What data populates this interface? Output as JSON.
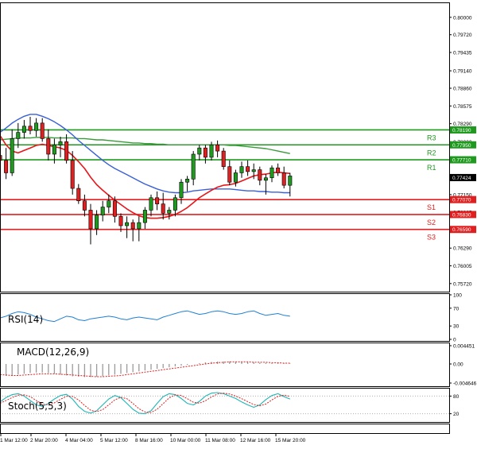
{
  "chart_data": {
    "type": "candlestick",
    "main": {
      "ylim": [
        0.7559,
        0.8024
      ],
      "price_ticks": [
        "0.80000",
        "0.79720",
        "0.79435",
        "0.79140",
        "0.78860",
        "0.78575",
        "0.78290",
        "0.78000",
        "0.77715",
        "0.77435",
        "0.77150",
        "0.76865",
        "0.76580",
        "0.76290",
        "0.76005",
        "0.75720"
      ],
      "tick_values": [
        0.8,
        0.7972,
        0.79435,
        0.7914,
        0.7886,
        0.78575,
        0.7829,
        0.78,
        0.77715,
        0.77435,
        0.7715,
        0.76865,
        0.7658,
        0.7629,
        0.76005,
        0.7572
      ],
      "current_price": {
        "label": "0.77424",
        "value": 0.77424
      },
      "levels": [
        {
          "name": "R3",
          "label": "0.78190",
          "value": 0.7819,
          "color": "#1f9a1f"
        },
        {
          "name": "R2",
          "label": "0.77950",
          "value": 0.7795,
          "color": "#1f9a1f"
        },
        {
          "name": "R1",
          "label": "0.77710",
          "value": 0.7771,
          "color": "#1f9a1f"
        },
        {
          "name": "S1",
          "label": "0.77070",
          "value": 0.7707,
          "color": "#e02020"
        },
        {
          "name": "S2",
          "label": "0.76830",
          "value": 0.7683,
          "color": "#e02020"
        },
        {
          "name": "S3",
          "label": "0.76590",
          "value": 0.7659,
          "color": "#e02020"
        }
      ],
      "candles": [
        {
          "o": 0.7778,
          "h": 0.78,
          "l": 0.776,
          "c": 0.777
        },
        {
          "o": 0.777,
          "h": 0.779,
          "l": 0.774,
          "c": 0.775
        },
        {
          "o": 0.775,
          "h": 0.782,
          "l": 0.7745,
          "c": 0.7805
        },
        {
          "o": 0.7805,
          "h": 0.783,
          "l": 0.779,
          "c": 0.7815
        },
        {
          "o": 0.7815,
          "h": 0.7835,
          "l": 0.7805,
          "c": 0.7825
        },
        {
          "o": 0.7825,
          "h": 0.784,
          "l": 0.7812,
          "c": 0.7818
        },
        {
          "o": 0.7818,
          "h": 0.7838,
          "l": 0.7808,
          "c": 0.783
        },
        {
          "o": 0.783,
          "h": 0.7838,
          "l": 0.78,
          "c": 0.7805
        },
        {
          "o": 0.7805,
          "h": 0.782,
          "l": 0.777,
          "c": 0.778
        },
        {
          "o": 0.778,
          "h": 0.7805,
          "l": 0.7765,
          "c": 0.7795
        },
        {
          "o": 0.7795,
          "h": 0.7808,
          "l": 0.7775,
          "c": 0.78
        },
        {
          "o": 0.78,
          "h": 0.7812,
          "l": 0.7765,
          "c": 0.777
        },
        {
          "o": 0.777,
          "h": 0.7785,
          "l": 0.7715,
          "c": 0.7725
        },
        {
          "o": 0.7725,
          "h": 0.7732,
          "l": 0.77,
          "c": 0.7705
        },
        {
          "o": 0.7705,
          "h": 0.7715,
          "l": 0.768,
          "c": 0.769
        },
        {
          "o": 0.769,
          "h": 0.77,
          "l": 0.7635,
          "c": 0.766
        },
        {
          "o": 0.766,
          "h": 0.769,
          "l": 0.765,
          "c": 0.7682
        },
        {
          "o": 0.7682,
          "h": 0.7705,
          "l": 0.7672,
          "c": 0.7695
        },
        {
          "o": 0.7695,
          "h": 0.7715,
          "l": 0.7685,
          "c": 0.7705
        },
        {
          "o": 0.7705,
          "h": 0.7712,
          "l": 0.767,
          "c": 0.768
        },
        {
          "o": 0.768,
          "h": 0.7685,
          "l": 0.7655,
          "c": 0.7665
        },
        {
          "o": 0.7665,
          "h": 0.768,
          "l": 0.7645,
          "c": 0.767
        },
        {
          "o": 0.767,
          "h": 0.7675,
          "l": 0.764,
          "c": 0.766
        },
        {
          "o": 0.766,
          "h": 0.768,
          "l": 0.764,
          "c": 0.767
        },
        {
          "o": 0.767,
          "h": 0.7695,
          "l": 0.766,
          "c": 0.769
        },
        {
          "o": 0.769,
          "h": 0.7715,
          "l": 0.768,
          "c": 0.771
        },
        {
          "o": 0.771,
          "h": 0.772,
          "l": 0.769,
          "c": 0.77
        },
        {
          "o": 0.77,
          "h": 0.7718,
          "l": 0.7675,
          "c": 0.7685
        },
        {
          "o": 0.7685,
          "h": 0.7695,
          "l": 0.7675,
          "c": 0.769
        },
        {
          "o": 0.769,
          "h": 0.7715,
          "l": 0.768,
          "c": 0.771
        },
        {
          "o": 0.771,
          "h": 0.774,
          "l": 0.77,
          "c": 0.7735
        },
        {
          "o": 0.7735,
          "h": 0.7745,
          "l": 0.772,
          "c": 0.774
        },
        {
          "o": 0.774,
          "h": 0.7785,
          "l": 0.773,
          "c": 0.778
        },
        {
          "o": 0.778,
          "h": 0.7795,
          "l": 0.777,
          "c": 0.779
        },
        {
          "o": 0.779,
          "h": 0.7795,
          "l": 0.7765,
          "c": 0.7775
        },
        {
          "o": 0.7775,
          "h": 0.78,
          "l": 0.777,
          "c": 0.7795
        },
        {
          "o": 0.7795,
          "h": 0.7802,
          "l": 0.7775,
          "c": 0.7785
        },
        {
          "o": 0.7785,
          "h": 0.779,
          "l": 0.7755,
          "c": 0.776
        },
        {
          "o": 0.776,
          "h": 0.777,
          "l": 0.773,
          "c": 0.7735
        },
        {
          "o": 0.7735,
          "h": 0.7755,
          "l": 0.7728,
          "c": 0.775
        },
        {
          "o": 0.775,
          "h": 0.7768,
          "l": 0.7742,
          "c": 0.776
        },
        {
          "o": 0.776,
          "h": 0.777,
          "l": 0.7745,
          "c": 0.7752
        },
        {
          "o": 0.7752,
          "h": 0.7765,
          "l": 0.774,
          "c": 0.7755
        },
        {
          "o": 0.7755,
          "h": 0.776,
          "l": 0.773,
          "c": 0.7738
        },
        {
          "o": 0.7738,
          "h": 0.7748,
          "l": 0.7715,
          "c": 0.7742
        },
        {
          "o": 0.7742,
          "h": 0.7762,
          "l": 0.7735,
          "c": 0.7758
        },
        {
          "o": 0.7758,
          "h": 0.7765,
          "l": 0.7745,
          "c": 0.775
        },
        {
          "o": 0.775,
          "h": 0.776,
          "l": 0.7725,
          "c": 0.773
        },
        {
          "o": 0.773,
          "h": 0.775,
          "l": 0.7712,
          "c": 0.7745
        }
      ],
      "ma_fast": [
        0.781,
        0.7795,
        0.7785,
        0.7782,
        0.7786,
        0.779,
        0.7794,
        0.7796,
        0.7794,
        0.7792,
        0.779,
        0.7786,
        0.7778,
        0.7768,
        0.7757,
        0.7743,
        0.7731,
        0.7722,
        0.7714,
        0.7706,
        0.7699,
        0.7692,
        0.7686,
        0.7681,
        0.7678,
        0.7677,
        0.7677,
        0.7678,
        0.768,
        0.7683,
        0.7688,
        0.7694,
        0.7702,
        0.771,
        0.7716,
        0.7722,
        0.7727,
        0.773,
        0.7731,
        0.7733,
        0.7737,
        0.7741,
        0.7745,
        0.7747,
        0.7748,
        0.775,
        0.7751,
        0.775,
        0.7749
      ],
      "ma_mid": [
        0.7815,
        0.7822,
        0.783,
        0.7836,
        0.7841,
        0.7844,
        0.7844,
        0.7841,
        0.7837,
        0.7832,
        0.7826,
        0.7819,
        0.7811,
        0.7802,
        0.7794,
        0.7786,
        0.7778,
        0.777,
        0.7763,
        0.7757,
        0.7752,
        0.7747,
        0.7742,
        0.7737,
        0.7732,
        0.7728,
        0.7724,
        0.7721,
        0.7719,
        0.7718,
        0.7718,
        0.7719,
        0.7721,
        0.7722,
        0.7723,
        0.7724,
        0.7724,
        0.7724,
        0.7724,
        0.7723,
        0.7722,
        0.7721,
        0.7721,
        0.772,
        0.772,
        0.7719,
        0.7719,
        0.7718,
        0.7718
      ],
      "ma_slow": [
        0.7803,
        0.7804,
        0.7805,
        0.7806,
        0.7806,
        0.7806,
        0.7807,
        0.7807,
        0.7807,
        0.7806,
        0.7806,
        0.7806,
        0.7806,
        0.7805,
        0.7805,
        0.7804,
        0.7803,
        0.7803,
        0.7802,
        0.7801,
        0.78,
        0.7799,
        0.7798,
        0.7798,
        0.7797,
        0.7797,
        0.7796,
        0.7796,
        0.7795,
        0.7795,
        0.7795,
        0.7795,
        0.7795,
        0.7795,
        0.7795,
        0.7795,
        0.7795,
        0.7795,
        0.7794,
        0.7794,
        0.7793,
        0.7792,
        0.7791,
        0.779,
        0.7789,
        0.7787,
        0.7785,
        0.7783,
        0.7781
      ],
      "ma_colors": {
        "fast": "#e8161a",
        "mid": "#3b5fd6",
        "slow": "#3a9a3a"
      }
    },
    "rsi": {
      "label": "RSI(14)",
      "ticks": [
        "100",
        "70",
        "30",
        "0"
      ],
      "tick_values": [
        100,
        70,
        30,
        0
      ],
      "values": [
        48,
        52,
        58,
        62,
        60,
        56,
        50,
        46,
        42,
        40,
        46,
        52,
        50,
        44,
        42,
        46,
        48,
        50,
        52,
        50,
        46,
        44,
        48,
        50,
        48,
        46,
        44,
        50,
        54,
        58,
        62,
        64,
        60,
        56,
        58,
        62,
        64,
        62,
        58,
        56,
        58,
        62,
        64,
        58,
        54,
        56,
        58,
        54,
        52
      ],
      "color": "#1f7fd4"
    },
    "macd": {
      "label": "MACD(12,26,9)",
      "ticks": [
        "0.004451",
        "0.00",
        "-0.004646"
      ],
      "tick_values": [
        0.004451,
        0,
        -0.004646
      ],
      "hist": [
        -0.003,
        -0.0029,
        -0.0028,
        -0.0026,
        -0.0024,
        -0.0022,
        -0.0021,
        -0.0021,
        -0.0022,
        -0.0024,
        -0.0026,
        -0.0028,
        -0.003,
        -0.0031,
        -0.0032,
        -0.0032,
        -0.0031,
        -0.003,
        -0.0028,
        -0.0026,
        -0.0024,
        -0.0022,
        -0.002,
        -0.0018,
        -0.0016,
        -0.0014,
        -0.0012,
        -0.001,
        -0.0008,
        -0.0006,
        -0.0004,
        -0.0002,
        0.0,
        0.0002,
        0.0004,
        0.0005,
        0.0006,
        0.0006,
        0.0006,
        0.0005,
        0.0005,
        0.0004,
        0.0004,
        0.0003,
        0.0003,
        0.0002,
        0.0002,
        0.0001,
        0.0001
      ],
      "signal": [
        -0.0026,
        -0.0027,
        -0.0028,
        -0.0028,
        -0.0027,
        -0.0026,
        -0.0025,
        -0.0024,
        -0.0024,
        -0.0024,
        -0.0025,
        -0.0026,
        -0.0027,
        -0.0028,
        -0.0029,
        -0.003,
        -0.0031,
        -0.0031,
        -0.003,
        -0.0029,
        -0.0028,
        -0.0026,
        -0.0024,
        -0.0022,
        -0.002,
        -0.0018,
        -0.0016,
        -0.0014,
        -0.0012,
        -0.001,
        -0.0008,
        -0.0006,
        -0.0004,
        -0.0002,
        0.0,
        0.0002,
        0.0003,
        0.0004,
        0.0005,
        0.0005,
        0.0005,
        0.0005,
        0.0004,
        0.0004,
        0.0004,
        0.0003,
        0.0003,
        0.0002,
        0.0002
      ],
      "hist_color": "#9a9a9a",
      "signal_color": "#e02020"
    },
    "stoch": {
      "label": "Stoch(5,5,3)",
      "ticks": [
        "80",
        "20"
      ],
      "tick_values": [
        80,
        20
      ],
      "k": [
        60,
        75,
        85,
        88,
        80,
        65,
        50,
        45,
        55,
        70,
        82,
        86,
        70,
        45,
        28,
        22,
        30,
        50,
        70,
        82,
        75,
        55,
        35,
        22,
        20,
        30,
        55,
        78,
        88,
        85,
        72,
        55,
        50,
        62,
        80,
        90,
        92,
        88,
        80,
        72,
        60,
        50,
        42,
        50,
        68,
        82,
        88,
        78,
        70
      ],
      "d": [
        55,
        65,
        75,
        83,
        84,
        78,
        65,
        53,
        50,
        57,
        69,
        79,
        79,
        67,
        48,
        32,
        27,
        34,
        50,
        67,
        76,
        71,
        55,
        37,
        26,
        24,
        35,
        54,
        74,
        84,
        82,
        71,
        59,
        56,
        64,
        77,
        87,
        90,
        87,
        80,
        71,
        61,
        51,
        47,
        53,
        67,
        79,
        83,
        79
      ],
      "k_color": "#1fb5b5",
      "d_color": "#e02020"
    },
    "dates": [
      "1 Mar 12:00",
      "2 Mar 20:00",
      "4 Mar 04:00",
      "5 Mar 12:00",
      "8 Mar 16:00",
      "10 Mar 00:00",
      "11 Mar 08:00",
      "12 Mar 16:00",
      "15 Mar 20:00"
    ],
    "bullish_color": "#1f9a1f",
    "bearish_color": "#e02020"
  }
}
